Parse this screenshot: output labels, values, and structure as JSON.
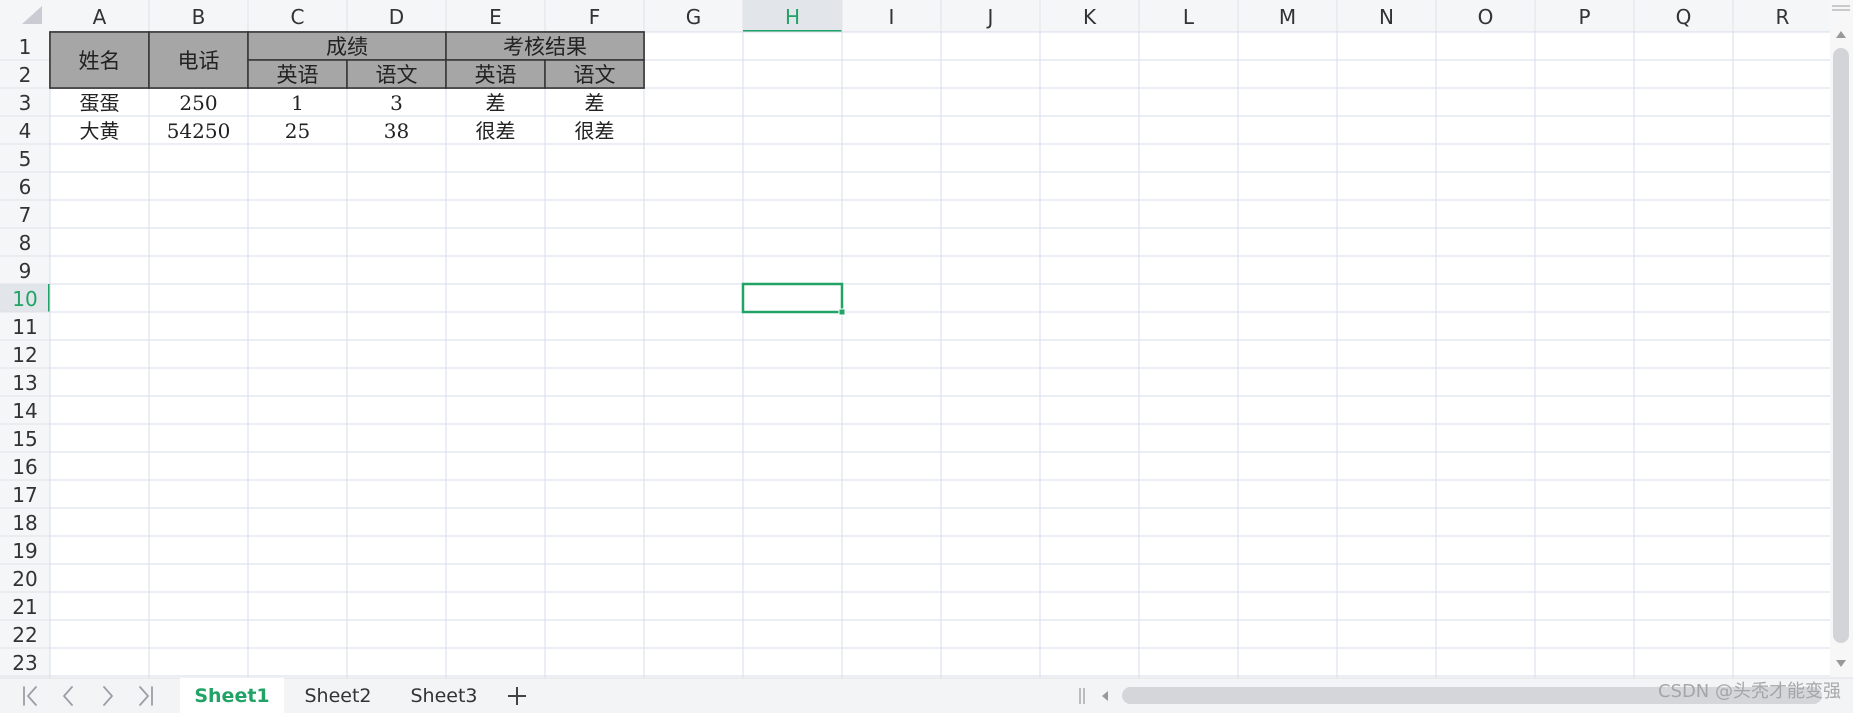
{
  "columns": [
    "A",
    "B",
    "C",
    "D",
    "E",
    "F",
    "G",
    "H",
    "I",
    "J",
    "K",
    "L",
    "M",
    "N",
    "O",
    "P",
    "Q",
    "R"
  ],
  "row_numbers": [
    "1",
    "2",
    "3",
    "4",
    "5",
    "6",
    "7",
    "8",
    "9",
    "10",
    "11",
    "12",
    "13",
    "14",
    "15",
    "16",
    "17",
    "18",
    "19",
    "20",
    "21",
    "22",
    "23"
  ],
  "active_cell": {
    "column": "H",
    "row": "10"
  },
  "merged_headers": {
    "name": "姓名",
    "phone": "电话",
    "scores": "成绩",
    "results": "考核结果"
  },
  "subheaders": {
    "C": "英语",
    "D": "语文",
    "E": "英语",
    "F": "语文"
  },
  "data_rows": [
    {
      "row": "3",
      "cells": [
        "蛋蛋",
        "250",
        "1",
        "3",
        "差",
        "差"
      ]
    },
    {
      "row": "4",
      "cells": [
        "大黄",
        "54250",
        "25",
        "38",
        "很差",
        "很差"
      ]
    }
  ],
  "sheet_tabs": [
    {
      "label": "Sheet1",
      "active": true
    },
    {
      "label": "Sheet2",
      "active": false
    },
    {
      "label": "Sheet3",
      "active": false
    }
  ],
  "add_sheet_icon": "plus-icon",
  "nav_icons": [
    "first-sheet-icon",
    "prev-sheet-icon",
    "next-sheet-icon",
    "last-sheet-icon"
  ],
  "watermark": "CSDN @头秃才能变强",
  "colors": {
    "accent": "#21a366",
    "header_fill": "#a6a6a6",
    "gridline": "#d8dcec",
    "header_bar": "#f5f6f8"
  }
}
